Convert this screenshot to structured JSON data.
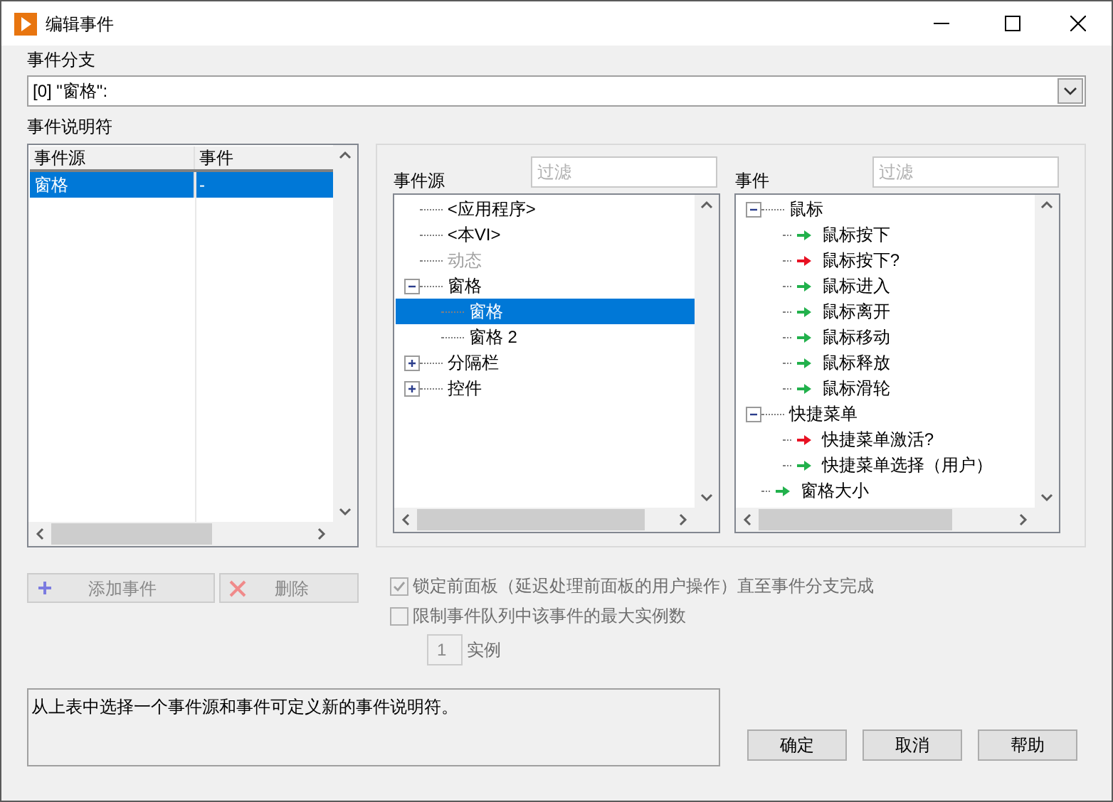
{
  "window": {
    "title": "编辑事件"
  },
  "event_case": {
    "label": "事件分支",
    "value": "[0] \"窗格\":"
  },
  "event_specifiers": {
    "label": "事件说明符",
    "columns": [
      "事件源",
      "事件"
    ],
    "rows": [
      {
        "cells": [
          "窗格",
          "-"
        ],
        "selected": true
      }
    ]
  },
  "source_panel": {
    "label": "事件源",
    "filter_placeholder": "过滤",
    "tree": [
      {
        "label": "<应用程序>",
        "selected": false,
        "disabled": false
      },
      {
        "label": "<本VI>",
        "selected": false,
        "disabled": false
      },
      {
        "label": "动态",
        "selected": false,
        "disabled": true
      },
      {
        "label": "窗格",
        "selected": false,
        "disabled": false,
        "expanded": true,
        "children": [
          {
            "label": "窗格",
            "selected": true,
            "disabled": false
          },
          {
            "label": "窗格 2",
            "selected": false,
            "disabled": false
          }
        ]
      },
      {
        "label": "分隔栏",
        "selected": false,
        "disabled": false,
        "expanded": false
      },
      {
        "label": "控件",
        "selected": false,
        "disabled": false,
        "expanded": false
      }
    ]
  },
  "event_panel": {
    "label": "事件",
    "filter_placeholder": "过滤",
    "tree": [
      {
        "label": "鼠标",
        "expanded": true,
        "children": [
          {
            "label": "鼠标按下",
            "color": "#22b14c"
          },
          {
            "label": "鼠标按下?",
            "color": "#e81123"
          },
          {
            "label": "鼠标进入",
            "color": "#22b14c"
          },
          {
            "label": "鼠标离开",
            "color": "#22b14c"
          },
          {
            "label": "鼠标移动",
            "color": "#22b14c"
          },
          {
            "label": "鼠标释放",
            "color": "#22b14c"
          },
          {
            "label": "鼠标滑轮",
            "color": "#22b14c"
          }
        ]
      },
      {
        "label": "快捷菜单",
        "expanded": true,
        "children": [
          {
            "label": "快捷菜单激活?",
            "color": "#e81123"
          },
          {
            "label": "快捷菜单选择（用户）",
            "color": "#22b14c"
          }
        ]
      },
      {
        "label": "窗格大小",
        "color": "#22b14c"
      }
    ]
  },
  "specifier_buttons": [
    {
      "label": "添加事件",
      "kind": "add",
      "disabled": true
    },
    {
      "label": "删除",
      "kind": "delete",
      "disabled": true
    }
  ],
  "options": [
    {
      "label": "锁定前面板（延迟处理前面板的用户操作）直至事件分支完成",
      "checked": true,
      "disabled": true
    },
    {
      "label": "限制事件队列中该事件的最大实例数",
      "checked": false,
      "disabled": true
    }
  ],
  "instances": {
    "value": "1",
    "unit": "实例",
    "disabled": true
  },
  "message": "从上表中选择一个事件源和事件可定义新的事件说明符。",
  "dialog_buttons": [
    "确定",
    "取消",
    "帮助"
  ]
}
